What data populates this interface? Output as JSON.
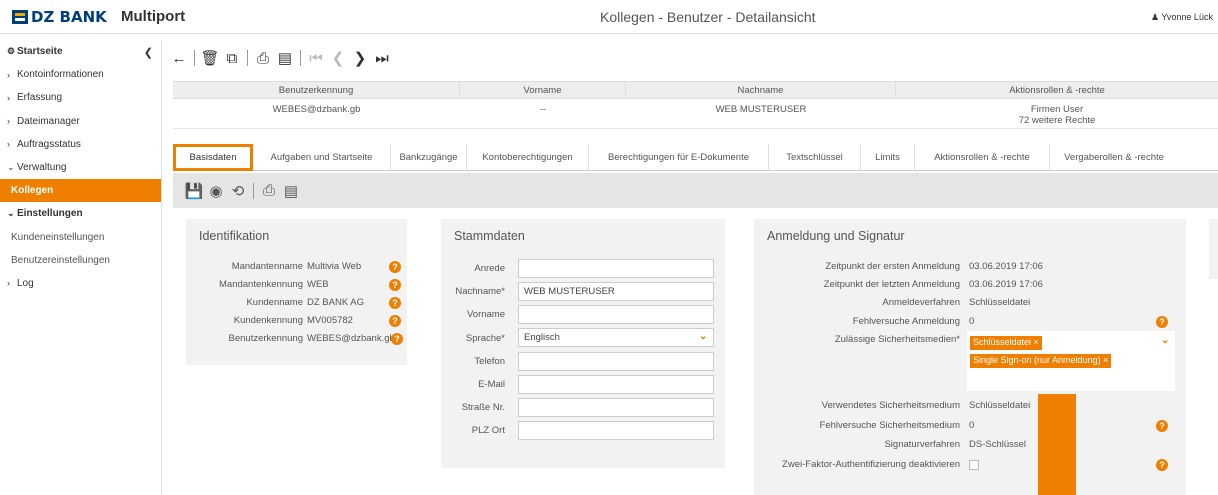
{
  "header": {
    "logo": "DZ BANK",
    "app": "Multiport",
    "title": "Kollegen - Benutzer - Detailansicht",
    "user": "Yvonne Lück"
  },
  "sidebar": {
    "items": [
      {
        "label": "Startseite",
        "glyph": "#"
      },
      {
        "label": "Kontoinformationen",
        "glyph": ">"
      },
      {
        "label": "Erfassung",
        "glyph": ">"
      },
      {
        "label": "Dateimanager",
        "glyph": ">"
      },
      {
        "label": "Auftragsstatus",
        "glyph": ">"
      },
      {
        "label": "Verwaltung",
        "glyph": "v"
      },
      {
        "label": "Kollegen",
        "glyph": ""
      },
      {
        "label": "Einstellungen",
        "glyph": "v"
      },
      {
        "label": "Kundeneinstellungen",
        "glyph": ""
      },
      {
        "label": "Benutzereinstellungen",
        "glyph": ""
      },
      {
        "label": "Log",
        "glyph": ">"
      }
    ]
  },
  "summary": {
    "headers": [
      "Benutzerkennung",
      "Vorname",
      "Nachname",
      "Aktionsrollen & -rechte"
    ],
    "row": {
      "benutzerkennung": "WEBES@dzbank.gb",
      "vorname": "--",
      "nachname": "WEB MUSTERUSER",
      "rollen": "Firmen User",
      "rechte": "72 weitere Rechte"
    }
  },
  "tabs": [
    "Basisdaten",
    "Aufgaben und Startseite",
    "Bankzugänge",
    "Kontoberechtigungen",
    "Berechtigungen für E-Dokumente",
    "Textschlüssel",
    "Limits",
    "Aktionsrollen & -rechte",
    "Vergaberollen & -rechte"
  ],
  "identifikation": {
    "title": "Identifikation",
    "rows": [
      {
        "label": "Mandantenname",
        "value": "Multivia Web"
      },
      {
        "label": "Mandantenkennung",
        "value": "WEB"
      },
      {
        "label": "Kundenname",
        "value": "DZ BANK AG"
      },
      {
        "label": "Kundenkennung",
        "value": "MV005782"
      },
      {
        "label": "Benutzerkennung",
        "value": "WEBES@dzbank.gb"
      }
    ]
  },
  "stammdaten": {
    "title": "Stammdaten",
    "fields": [
      {
        "label": "Anrede",
        "value": ""
      },
      {
        "label": "Nachname*",
        "value": "WEB MUSTERUSER"
      },
      {
        "label": "Vorname",
        "value": ""
      },
      {
        "label": "Sprache*",
        "value": "Englisch"
      },
      {
        "label": "Telefon",
        "value": ""
      },
      {
        "label": "E-Mail",
        "value": ""
      },
      {
        "label": "Straße Nr.",
        "value": ""
      },
      {
        "label": "PLZ Ort",
        "value": ""
      }
    ]
  },
  "anmeldung": {
    "title": "Anmeldung und Signatur",
    "rows_top": [
      {
        "label": "Zeitpunkt der ersten Anmeldung",
        "value": "03.06.2019 17:06"
      },
      {
        "label": "Zeitpunkt der letzten Anmeldung",
        "value": "03.06.2019 17:06"
      },
      {
        "label": "Anmeldeverfahren",
        "value": "Schlüsseldatei"
      },
      {
        "label": "Fehlversuche Anmeldung",
        "value": "0"
      }
    ],
    "medien_label": "Zulässige Sicherheitsmedien*",
    "medien_tags": [
      "Schlüsseldatei ×",
      "Single Sign-on (nur Anmeldung) ×"
    ],
    "rows_bottom": [
      {
        "label": "Verwendetes Sicherheitsmedium",
        "value": "Schlüsseldatei"
      },
      {
        "label": "Fehlversuche Sicherheitsmedium",
        "value": "0"
      },
      {
        "label": "Signaturverfahren",
        "value": "DS-Schlüssel"
      }
    ],
    "zweifaktor_label": "Zwei-Faktor-Authentifizierung deaktivieren",
    "zweifaktor_checked": false
  }
}
